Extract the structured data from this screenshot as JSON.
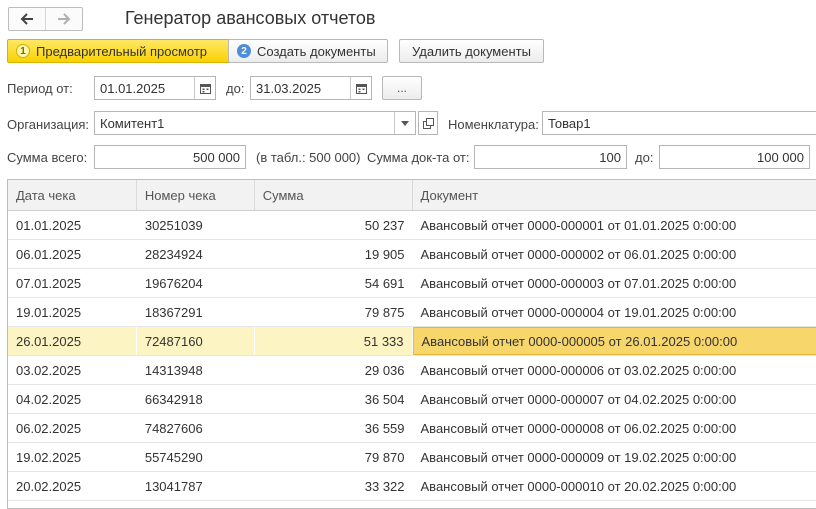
{
  "window": {
    "title": "Генератор авансовых отчетов"
  },
  "toolbar": {
    "preview": {
      "num": "1",
      "label": "Предварительный просмотр"
    },
    "create": {
      "num": "2",
      "label": "Создать документы"
    },
    "delete": {
      "label": "Удалить документы"
    }
  },
  "period": {
    "from_label": "Период от:",
    "from_value": "01.01.2025",
    "to_label": "до:",
    "to_value": "31.03.2025",
    "more_label": "..."
  },
  "org": {
    "label": "Организация:",
    "value": "Комитент1"
  },
  "nomenclature": {
    "label": "Номенклатура:",
    "value": "Товар1"
  },
  "sum": {
    "label": "Сумма всего:",
    "value": "500 000",
    "table_note": "(в табл.: 500 000)",
    "doc_from_label": "Сумма док-та от:",
    "doc_from_value": "100",
    "doc_to_label": "до:",
    "doc_to_value": "100 000"
  },
  "table": {
    "columns": [
      "Дата чека",
      "Номер чека",
      "Сумма",
      "Документ"
    ],
    "rows": [
      [
        "01.01.2025",
        "30251039",
        "50 237",
        "Авансовый отчет 0000-000001 от 01.01.2025 0:00:00"
      ],
      [
        "06.01.2025",
        "28234924",
        "19 905",
        "Авансовый отчет 0000-000002 от 06.01.2025 0:00:00"
      ],
      [
        "07.01.2025",
        "19676204",
        "54 691",
        "Авансовый отчет 0000-000003 от 07.01.2025 0:00:00"
      ],
      [
        "19.01.2025",
        "18367291",
        "79 875",
        "Авансовый отчет 0000-000004 от 19.01.2025 0:00:00"
      ],
      [
        "26.01.2025",
        "72487160",
        "51 333",
        "Авансовый отчет 0000-000005 от 26.01.2025 0:00:00"
      ],
      [
        "03.02.2025",
        "14313948",
        "29 036",
        "Авансовый отчет 0000-000006 от 03.02.2025 0:00:00"
      ],
      [
        "04.02.2025",
        "66342918",
        "36 504",
        "Авансовый отчет 0000-000007 от 04.02.2025 0:00:00"
      ],
      [
        "06.02.2025",
        "74827606",
        "36 559",
        "Авансовый отчет 0000-000008 от 06.02.2025 0:00:00"
      ],
      [
        "19.02.2025",
        "55745290",
        "79 870",
        "Авансовый отчет 0000-000009 от 19.02.2025 0:00:00"
      ],
      [
        "20.02.2025",
        "13041787",
        "33 322",
        "Авансовый отчет 0000-000010 от 20.02.2025 0:00:00"
      ]
    ],
    "selected_row": 4
  },
  "colors": {
    "accent": "#f9d200",
    "selected_row": "#fdf4c4",
    "selected_cell": "#f7d66c"
  }
}
